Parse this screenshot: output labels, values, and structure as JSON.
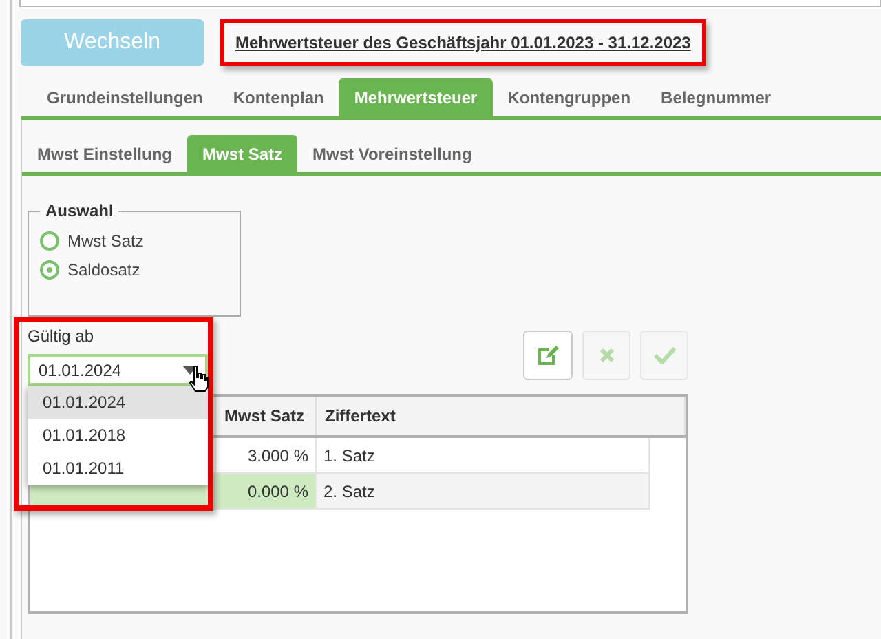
{
  "switch_button": {
    "label": "Wechseln",
    "disabled": true
  },
  "fiscal_year_link": "Mehrwertsteuer des Geschäftsjahr 01.01.2023 - 31.12.2023",
  "tabs": [
    {
      "label": "Grundeinstellungen",
      "selected": false
    },
    {
      "label": "Kontenplan",
      "selected": false
    },
    {
      "label": "Mehrwertsteuer",
      "selected": true
    },
    {
      "label": "Kontengruppen",
      "selected": false
    },
    {
      "label": "Belegnummer",
      "selected": false
    }
  ],
  "subtabs": [
    {
      "label": "Mwst Einstellung",
      "selected": false
    },
    {
      "label": "Mwst Satz",
      "selected": true
    },
    {
      "label": "Mwst Voreinstellung",
      "selected": false
    }
  ],
  "selection_group": {
    "title": "Auswahl",
    "options": [
      {
        "label": "Mwst Satz",
        "selected": false
      },
      {
        "label": "Saldosatz",
        "selected": true
      }
    ]
  },
  "valid_from": {
    "label": "Gültig ab",
    "value": "01.01.2024",
    "options": [
      {
        "label": "01.01.2024",
        "selected": true
      },
      {
        "label": "01.01.2018",
        "selected": false
      },
      {
        "label": "01.01.2011",
        "selected": false
      }
    ]
  },
  "toolbar": [
    {
      "kind": "edit",
      "disabled": false
    },
    {
      "kind": "cancel",
      "disabled": true
    },
    {
      "kind": "confirm",
      "disabled": true
    }
  ],
  "table": {
    "columns": [
      "Mwst Satz",
      "Ziffertext"
    ],
    "rows": [
      {
        "rate": "3.000 %",
        "text": "1. Satz",
        "highlighted": false
      },
      {
        "rate": "0.000 %",
        "text": "2. Satz",
        "highlighted": true
      }
    ]
  }
}
